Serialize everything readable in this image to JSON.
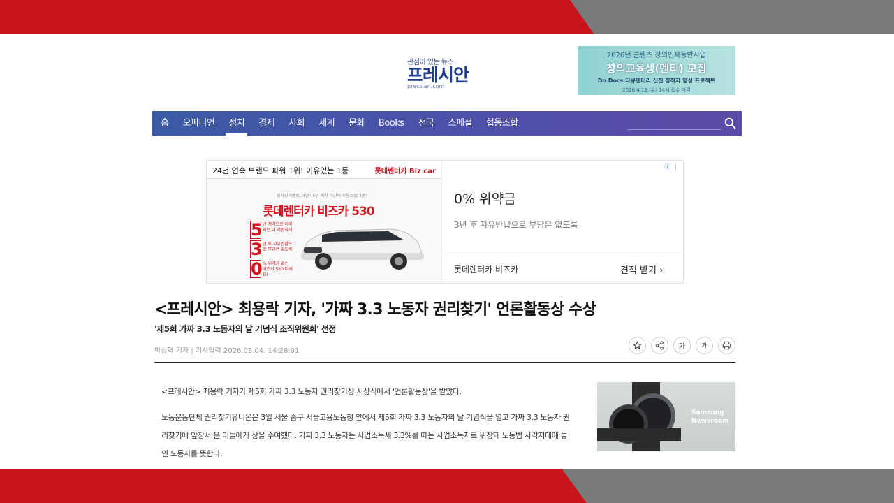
{
  "logo": {
    "tagline": "관점이 있는 뉴스",
    "name": "프레시안",
    "domain": "pressian.com"
  },
  "top_banner": {
    "line1": "2026년 콘텐츠 창의인재동반사업",
    "line2": "창의교육생(멘티) 모집",
    "line3": "Do Docs 다큐멘터리 신진 창작자 양성 프로젝트",
    "line4": "2026.4.15.(수) 14시 접수 마감"
  },
  "nav": {
    "items": [
      "홈",
      "오피니언",
      "정치",
      "경제",
      "사회",
      "세계",
      "문화",
      "Books",
      "전국",
      "스페셜",
      "협동조합"
    ],
    "active": "정치"
  },
  "ad": {
    "left_top": "24년 연속 브랜드 파워 1위! 이유있는 1등",
    "left_top_bold1": "1위",
    "brand": "롯데렌터카 Biz car",
    "small": "신차장기렌트, 4년~5년 계약 기간의 부담스럽다면?",
    "headline": "롯데렌터카 비즈카 530",
    "points": [
      {
        "num": "5",
        "text": "년 계약으로 이어지는 더 저렴하게"
      },
      {
        "num": "3",
        "text": "년 후 자유반납으로 부담은 없도록"
      },
      {
        "num": "0",
        "text": "% 위약금 없는 비즈카 530 타세요!"
      }
    ],
    "right_title": "0% 위약금",
    "right_sub": "3년 후 자유반납으로 부담은 없도록",
    "right_brand": "롯데렌터카 비즈카",
    "right_cta": "견적 받기"
  },
  "article": {
    "headline": "<프레시안> 최용락 기자, '가짜 3.3 노동자 권리찾기' 언론활동상 수상",
    "subhead": "'제5회 가짜 3.3 노동자의 날 기념식 조직위원회' 선정",
    "byline": "박상혁 기자 | 기사입력 2026.03.04. 14:28:01",
    "tools": {
      "font_up": "가",
      "font_down": "가"
    },
    "paragraphs": [
      "<프레시안> 최용락 기자가 제5회 가짜 3.3 노동자 권리찾기상 시상식에서 '언론활동상'을 받았다.",
      "노동운동단체 권리찾기유니온은 3일 서울 중구 서울고용노동청 앞에서 제5회 가짜 3.3 노동자의 날 기념식을 열고 가짜 3.3 노동자 권리찾기에 앞장서 온 이들에게 상을 수여했다. 가짜 3.3 노동자는 사업소득세 3.3%를 떼는 사업소득자로 위장돼 노동법 사각지대에 놓인 노동자를 뜻한다."
    ]
  },
  "side_ad": {
    "line1": "Samsung",
    "line2": "Newsroom"
  },
  "colors": {
    "nav": "#3f55a8",
    "frame_red": "#c8141b",
    "frame_gray": "#7a7a7a",
    "logo": "#1f3e91"
  }
}
